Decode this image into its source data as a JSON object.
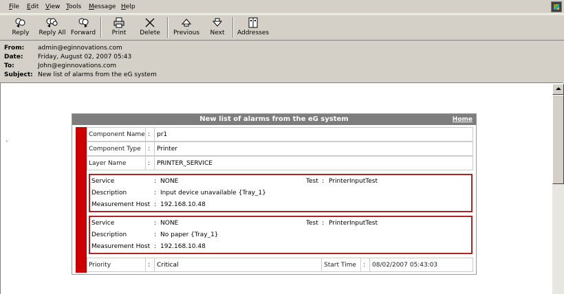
{
  "menu": {
    "items": [
      {
        "key": "F",
        "rest": "ile"
      },
      {
        "key": "E",
        "rest": "dit"
      },
      {
        "key": "V",
        "rest": "iew"
      },
      {
        "key": "T",
        "rest": "ools"
      },
      {
        "key": "M",
        "rest": "essage"
      },
      {
        "key": "H",
        "rest": "elp"
      }
    ]
  },
  "toolbar": {
    "reply": "Reply",
    "reply_all": "Reply All",
    "forward": "Forward",
    "print": "Print",
    "delete": "Delete",
    "previous": "Previous",
    "next": "Next",
    "addresses": "Addresses"
  },
  "headers": {
    "from_label": "From:",
    "from_value": "admin@eginnovations.com",
    "date_label": "Date:",
    "date_value": "Friday, August 02, 2007  05:43",
    "to_label": "To:",
    "to_value": "John@eginnovations.com",
    "subject_label": "Subject:",
    "subject_value": "New list of alarms from the eG system"
  },
  "body": {
    "stray_mark": "`",
    "card": {
      "title": "New list of alarms from the eG system",
      "home_link": "Home",
      "component_name_label": "Component Name",
      "component_name_value": "pr1",
      "component_type_label": "Component Type",
      "component_type_value": "Printer",
      "layer_name_label": "Layer Name",
      "layer_name_value": "PRINTER_SERVICE",
      "colon": ":",
      "alarms": [
        {
          "service_label": "Service",
          "service_value": "NONE",
          "test_label": "Test",
          "test_value": "PrinterInputTest",
          "description_label": "Description",
          "description_value": "Input device unavailable {Tray_1}",
          "host_label": "Measurement Host",
          "host_value": "192.168.10.48"
        },
        {
          "service_label": "Service",
          "service_value": "NONE",
          "test_label": "Test",
          "test_value": "PrinterInputTest",
          "description_label": "Description",
          "description_value": "No paper {Tray_1}",
          "host_label": "Measurement Host",
          "host_value": "192.168.10.48"
        }
      ],
      "priority_label": "Priority",
      "priority_value": "Critical",
      "start_time_label": "Start Time",
      "start_time_value": "08/02/2007 05:43:03"
    }
  },
  "colors": {
    "alarm_red": "#cc0000",
    "alarm_border": "#b22222",
    "title_bar": "#7d7d7d",
    "chrome": "#d4d0c8"
  }
}
